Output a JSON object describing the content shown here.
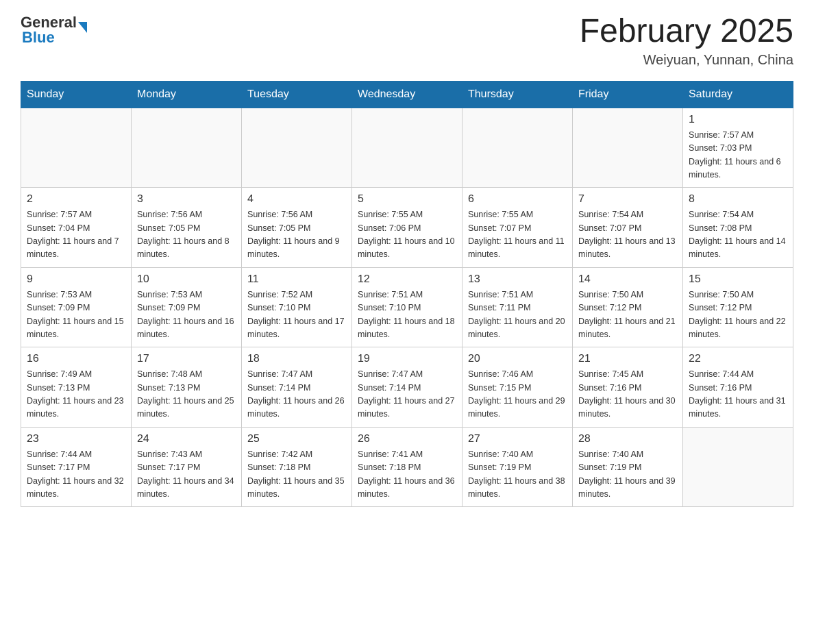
{
  "header": {
    "logo_general": "General",
    "logo_blue": "Blue",
    "title": "February 2025",
    "subtitle": "Weiyuan, Yunnan, China"
  },
  "days_of_week": [
    "Sunday",
    "Monday",
    "Tuesday",
    "Wednesday",
    "Thursday",
    "Friday",
    "Saturday"
  ],
  "weeks": [
    [
      {
        "day": "",
        "info": ""
      },
      {
        "day": "",
        "info": ""
      },
      {
        "day": "",
        "info": ""
      },
      {
        "day": "",
        "info": ""
      },
      {
        "day": "",
        "info": ""
      },
      {
        "day": "",
        "info": ""
      },
      {
        "day": "1",
        "info": "Sunrise: 7:57 AM\nSunset: 7:03 PM\nDaylight: 11 hours and 6 minutes."
      }
    ],
    [
      {
        "day": "2",
        "info": "Sunrise: 7:57 AM\nSunset: 7:04 PM\nDaylight: 11 hours and 7 minutes."
      },
      {
        "day": "3",
        "info": "Sunrise: 7:56 AM\nSunset: 7:05 PM\nDaylight: 11 hours and 8 minutes."
      },
      {
        "day": "4",
        "info": "Sunrise: 7:56 AM\nSunset: 7:05 PM\nDaylight: 11 hours and 9 minutes."
      },
      {
        "day": "5",
        "info": "Sunrise: 7:55 AM\nSunset: 7:06 PM\nDaylight: 11 hours and 10 minutes."
      },
      {
        "day": "6",
        "info": "Sunrise: 7:55 AM\nSunset: 7:07 PM\nDaylight: 11 hours and 11 minutes."
      },
      {
        "day": "7",
        "info": "Sunrise: 7:54 AM\nSunset: 7:07 PM\nDaylight: 11 hours and 13 minutes."
      },
      {
        "day": "8",
        "info": "Sunrise: 7:54 AM\nSunset: 7:08 PM\nDaylight: 11 hours and 14 minutes."
      }
    ],
    [
      {
        "day": "9",
        "info": "Sunrise: 7:53 AM\nSunset: 7:09 PM\nDaylight: 11 hours and 15 minutes."
      },
      {
        "day": "10",
        "info": "Sunrise: 7:53 AM\nSunset: 7:09 PM\nDaylight: 11 hours and 16 minutes."
      },
      {
        "day": "11",
        "info": "Sunrise: 7:52 AM\nSunset: 7:10 PM\nDaylight: 11 hours and 17 minutes."
      },
      {
        "day": "12",
        "info": "Sunrise: 7:51 AM\nSunset: 7:10 PM\nDaylight: 11 hours and 18 minutes."
      },
      {
        "day": "13",
        "info": "Sunrise: 7:51 AM\nSunset: 7:11 PM\nDaylight: 11 hours and 20 minutes."
      },
      {
        "day": "14",
        "info": "Sunrise: 7:50 AM\nSunset: 7:12 PM\nDaylight: 11 hours and 21 minutes."
      },
      {
        "day": "15",
        "info": "Sunrise: 7:50 AM\nSunset: 7:12 PM\nDaylight: 11 hours and 22 minutes."
      }
    ],
    [
      {
        "day": "16",
        "info": "Sunrise: 7:49 AM\nSunset: 7:13 PM\nDaylight: 11 hours and 23 minutes."
      },
      {
        "day": "17",
        "info": "Sunrise: 7:48 AM\nSunset: 7:13 PM\nDaylight: 11 hours and 25 minutes."
      },
      {
        "day": "18",
        "info": "Sunrise: 7:47 AM\nSunset: 7:14 PM\nDaylight: 11 hours and 26 minutes."
      },
      {
        "day": "19",
        "info": "Sunrise: 7:47 AM\nSunset: 7:14 PM\nDaylight: 11 hours and 27 minutes."
      },
      {
        "day": "20",
        "info": "Sunrise: 7:46 AM\nSunset: 7:15 PM\nDaylight: 11 hours and 29 minutes."
      },
      {
        "day": "21",
        "info": "Sunrise: 7:45 AM\nSunset: 7:16 PM\nDaylight: 11 hours and 30 minutes."
      },
      {
        "day": "22",
        "info": "Sunrise: 7:44 AM\nSunset: 7:16 PM\nDaylight: 11 hours and 31 minutes."
      }
    ],
    [
      {
        "day": "23",
        "info": "Sunrise: 7:44 AM\nSunset: 7:17 PM\nDaylight: 11 hours and 32 minutes."
      },
      {
        "day": "24",
        "info": "Sunrise: 7:43 AM\nSunset: 7:17 PM\nDaylight: 11 hours and 34 minutes."
      },
      {
        "day": "25",
        "info": "Sunrise: 7:42 AM\nSunset: 7:18 PM\nDaylight: 11 hours and 35 minutes."
      },
      {
        "day": "26",
        "info": "Sunrise: 7:41 AM\nSunset: 7:18 PM\nDaylight: 11 hours and 36 minutes."
      },
      {
        "day": "27",
        "info": "Sunrise: 7:40 AM\nSunset: 7:19 PM\nDaylight: 11 hours and 38 minutes."
      },
      {
        "day": "28",
        "info": "Sunrise: 7:40 AM\nSunset: 7:19 PM\nDaylight: 11 hours and 39 minutes."
      },
      {
        "day": "",
        "info": ""
      }
    ]
  ]
}
